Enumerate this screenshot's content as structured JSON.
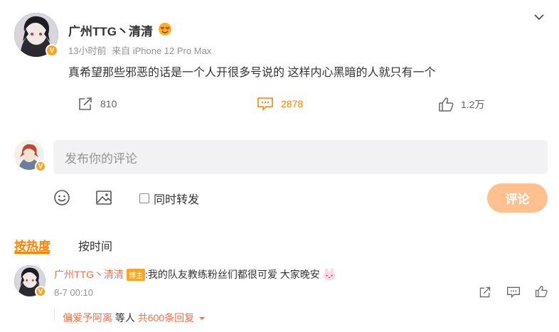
{
  "post": {
    "author_name": "广州TTG丶清清",
    "time": "13小时前",
    "source": "来自 iPhone 12 Pro Max",
    "text": "真希望那些邪恶的话是一个人开很多号说的 这样内心黑暗的人就只有一个",
    "actions": {
      "repost_count": "810",
      "comment_count": "2878",
      "like_count": "1.2万"
    },
    "verified_badge": "V",
    "author_emoji": "heart-eyes-emoji"
  },
  "composer": {
    "placeholder": "发布你的评论",
    "sync_repost_label": "同时转发",
    "submit_label": "评论"
  },
  "sort": {
    "hot_label": "按热度",
    "time_label": "按时间",
    "active": "hot"
  },
  "comments": [
    {
      "author": "广州TTG丶清清",
      "role_badge": "博主",
      "text": ":我的队友教练粉丝们都很可爱 大家晚安",
      "time": "8-7 00:10",
      "reply_summary": {
        "user": "偏爱予阿离",
        "mid": "等人",
        "count": "共600条回复"
      }
    }
  ],
  "colors": {
    "accent": "#ff8200",
    "name_link": "#eb7350",
    "badge": "#f5a623",
    "submit_disabled": "#ffc090",
    "input_bg": "#f2f2f5"
  },
  "icons": [
    "chevron-down-icon",
    "repost-icon",
    "comment-icon",
    "like-icon",
    "emoji-icon",
    "image-icon",
    "share-icon",
    "reply-icon"
  ]
}
